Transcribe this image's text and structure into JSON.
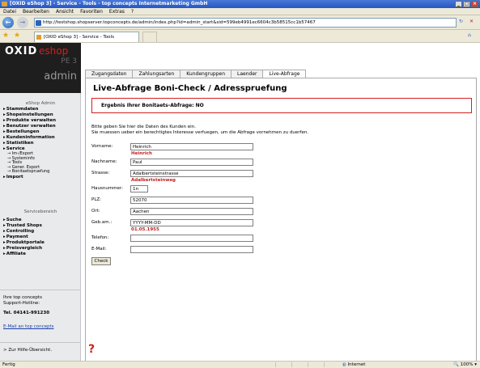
{
  "window": {
    "title": "[OXID eShop 3] - Service - Tools - top concepts Internetmarketing GmbH"
  },
  "menu": [
    "Datei",
    "Bearbeiten",
    "Ansicht",
    "Favoriten",
    "Extras",
    "?"
  ],
  "address": {
    "url": "http://testshop.shopserver.topconcepts.de/admin/index.php?id=admin_start&sid=599eb4991ec6604c3b58515cc1b57467"
  },
  "tab": {
    "title": "[OXID eShop 3] - Service - Tools"
  },
  "logo": {
    "brand": "OXID",
    "eshop": "eshop",
    "edition": "PE 3",
    "admin": "admin"
  },
  "sidebar": {
    "header": "eShop Admin",
    "items": [
      "Stammdaten",
      "Shopeinstellungen",
      "Produkte verwalten",
      "Benutzer verwalten",
      "Bestellungen",
      "Kundeninformation",
      "Statistiken",
      "Service"
    ],
    "sub": [
      "Im-/Export",
      "Systeminfo",
      "Tools",
      "Gener. Export",
      "Bonitaetspruefung"
    ],
    "item_import": "Import",
    "header2": "Servicebereich",
    "items2": [
      "Suche",
      "Trusted Shops",
      "Controlling",
      "Payment",
      "Produktportale",
      "Preisvergleich",
      "Affiliate"
    ],
    "support_label": "Ihre top concepts Support-Hotline:",
    "support_tel": "Tel. 04141-991230",
    "email_link": "E-Mail an top concepts",
    "help_link": "> Zur Hilfe-Übersicht."
  },
  "tabs": [
    "Zugangsdaten",
    "Zahlungsarten",
    "Kundengruppen",
    "Laender",
    "Live-Abfrage"
  ],
  "page": {
    "title": "Live-Abfrage Boni-Check / Adresspruefung",
    "result": "Ergebnis Ihrer Bonitaets-Abfrage: NO",
    "info1": "Bitte geben Sie hier die Daten des Kunden ein.",
    "info2": "Sie muessen ueber ein berechtigtes Interesse verfuegen, um die Abfrage vornehmen zu duerfen.",
    "check_button": "Check",
    "help_icon": "?"
  },
  "form": [
    {
      "label": "Vorname:",
      "value": "Heinrich",
      "suggest": "Heinrich"
    },
    {
      "label": "Nachname:",
      "value": "Paul",
      "suggest": ""
    },
    {
      "label": "Strasse:",
      "value": "Adalbertsteinstrasse",
      "suggest": "Adalbertsteinweg"
    },
    {
      "label": "Hausnummer:",
      "value": "1n",
      "suggest": ""
    },
    {
      "label": "PLZ:",
      "value": "52070",
      "suggest": ""
    },
    {
      "label": "Ort:",
      "value": "Aachen",
      "suggest": ""
    },
    {
      "label": "Geb.am.:",
      "value": "YYYY-MM-DD",
      "suggest": "01.05.1955"
    },
    {
      "label": "Telefon:",
      "value": "",
      "suggest": ""
    },
    {
      "label": "E-Mail:",
      "value": "",
      "suggest": ""
    }
  ],
  "status": {
    "left": "Fertig",
    "zone": "Internet",
    "zoom": "100%"
  }
}
